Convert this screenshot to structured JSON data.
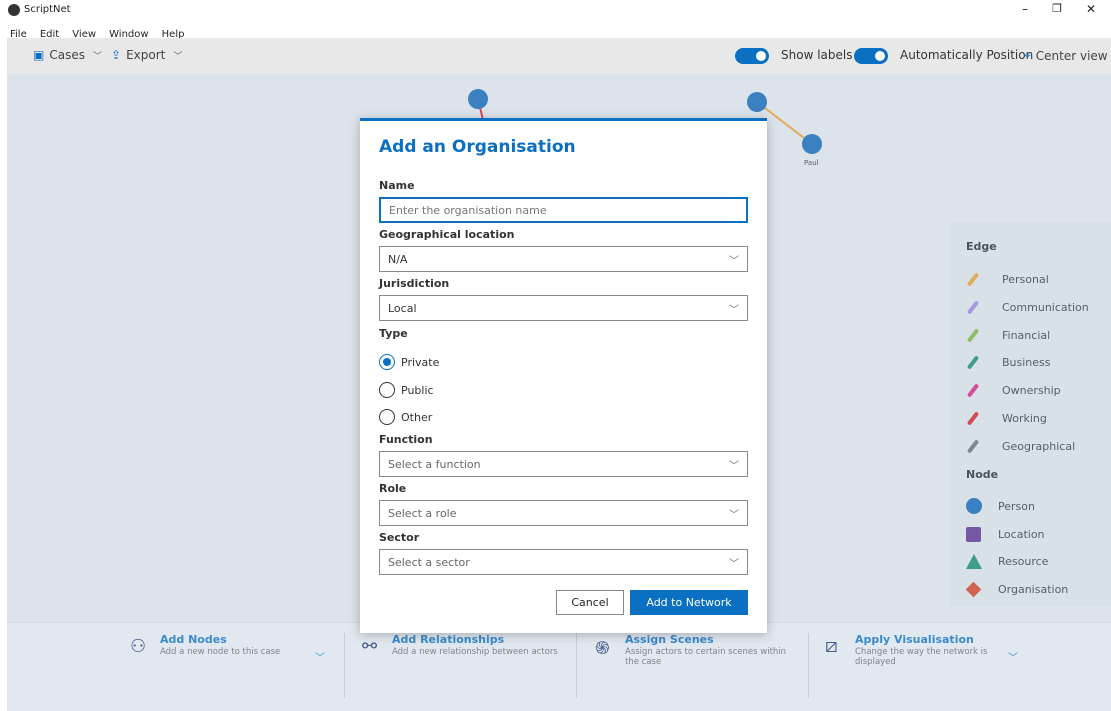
{
  "app": {
    "title": "ScriptNet"
  },
  "menu": [
    "File",
    "Edit",
    "View",
    "Window",
    "Help"
  ],
  "toolbar": {
    "cases_label": "Cases",
    "export_label": "Export",
    "show_labels": "Show labels",
    "auto_position": "Automatically Position",
    "center_view": "Center view"
  },
  "network": {
    "node_labels": {
      "paul": "Paul"
    }
  },
  "legend": {
    "edge_title": "Edge",
    "edges": [
      {
        "label": "Personal",
        "color": "#f0a020"
      },
      {
        "label": "Communication",
        "color": "#9b84d8"
      },
      {
        "label": "Financial",
        "color": "#7cb82f"
      },
      {
        "label": "Business",
        "color": "#0f8a6a"
      },
      {
        "label": "Ownership",
        "color": "#e0197d"
      },
      {
        "label": "Working",
        "color": "#d71920"
      },
      {
        "label": "Geographical",
        "color": "#6b6b6b"
      }
    ],
    "node_title": "Node",
    "nodes": [
      {
        "label": "Person",
        "shape": "circle",
        "color": "#0b62b0"
      },
      {
        "label": "Location",
        "shape": "square",
        "color": "#5a2a86"
      },
      {
        "label": "Resource",
        "shape": "triangle",
        "color": "#0e8a64"
      },
      {
        "label": "Organisation",
        "shape": "diamond",
        "color": "#d83b1a"
      }
    ]
  },
  "bottom": {
    "add_nodes": {
      "title": "Add Nodes",
      "desc": "Add a new node to this case"
    },
    "add_relationships": {
      "title": "Add Relationships",
      "desc": "Add a new relationship between actors"
    },
    "assign_scenes": {
      "title": "Assign Scenes",
      "desc": "Assign actors to certain scenes within the case"
    },
    "apply_visualisation": {
      "title": "Apply Visualisation",
      "desc": "Change the way the network is displayed"
    }
  },
  "modal": {
    "title": "Add an Organisation",
    "name_label": "Name",
    "name_placeholder": "Enter the organisation name",
    "geo_label": "Geographical location",
    "geo_value": "N/A",
    "jurisdiction_label": "Jurisdiction",
    "jurisdiction_value": "Local",
    "type_label": "Type",
    "type_options": [
      "Private",
      "Public",
      "Other"
    ],
    "type_selected": "Private",
    "function_label": "Function",
    "function_placeholder": "Select a function",
    "role_label": "Role",
    "role_placeholder": "Select a role",
    "sector_label": "Sector",
    "sector_placeholder": "Select a sector",
    "cancel_label": "Cancel",
    "submit_label": "Add to Network"
  },
  "colors": {
    "accent": "#0b6fc2",
    "person_node": "#0b62b0"
  }
}
